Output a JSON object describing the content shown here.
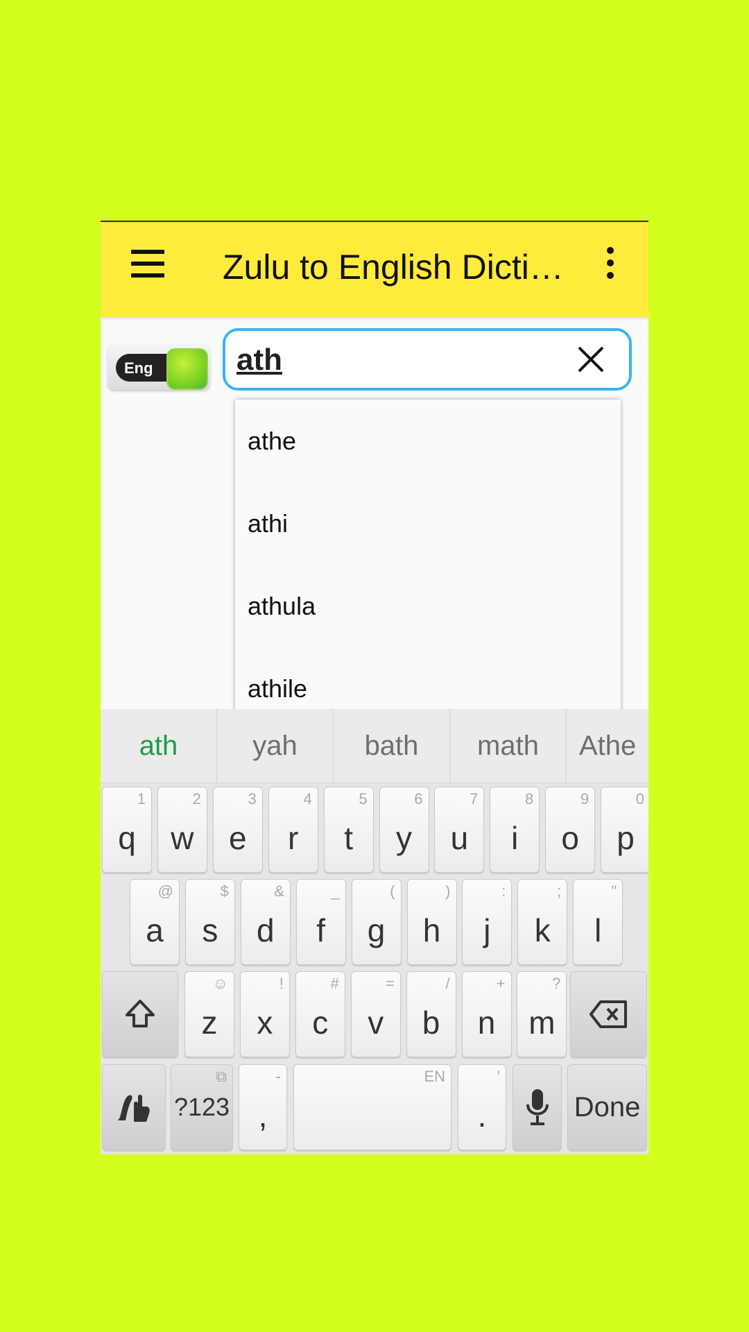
{
  "app": {
    "title": "Zulu to English Dicti…",
    "menu_icon": "hamburger-menu-icon",
    "overflow_icon": "more-vert-icon"
  },
  "language_toggle": {
    "label": "Eng",
    "state": "on"
  },
  "search": {
    "value": "ath",
    "clear_icon": "close-icon",
    "focus_color": "#39b5f0"
  },
  "suggestions": [
    "athe",
    "athi",
    "athula",
    "athile"
  ],
  "keyboard": {
    "candidates": [
      "ath",
      "yah",
      "bath",
      "math",
      "Athe"
    ],
    "row1": [
      {
        "key": "q",
        "hint": "1"
      },
      {
        "key": "w",
        "hint": "2"
      },
      {
        "key": "e",
        "hint": "3"
      },
      {
        "key": "r",
        "hint": "4"
      },
      {
        "key": "t",
        "hint": "5"
      },
      {
        "key": "y",
        "hint": "6"
      },
      {
        "key": "u",
        "hint": "7"
      },
      {
        "key": "i",
        "hint": "8"
      },
      {
        "key": "o",
        "hint": "9"
      },
      {
        "key": "p",
        "hint": "0"
      }
    ],
    "row2": [
      {
        "key": "a",
        "hint": "@"
      },
      {
        "key": "s",
        "hint": "$"
      },
      {
        "key": "d",
        "hint": "&"
      },
      {
        "key": "f",
        "hint": "_"
      },
      {
        "key": "g",
        "hint": "("
      },
      {
        "key": "h",
        "hint": ")"
      },
      {
        "key": "j",
        "hint": ":"
      },
      {
        "key": "k",
        "hint": ";"
      },
      {
        "key": "l",
        "hint": "\""
      }
    ],
    "row3": [
      {
        "key": "z",
        "hint": "☺"
      },
      {
        "key": "x",
        "hint": "!"
      },
      {
        "key": "c",
        "hint": "#"
      },
      {
        "key": "v",
        "hint": "="
      },
      {
        "key": "b",
        "hint": "/"
      },
      {
        "key": "n",
        "hint": "+"
      },
      {
        "key": "m",
        "hint": "?"
      }
    ],
    "symbols_label": "?123",
    "comma": ",",
    "comma_hint": "-",
    "space_hint": "EN",
    "period": ".",
    "period_hint": "'",
    "done_label": "Done"
  },
  "colors": {
    "background": "#d3ff1c",
    "appbar": "#ffeb3b",
    "candidate_primary": "#1f9a4b"
  }
}
